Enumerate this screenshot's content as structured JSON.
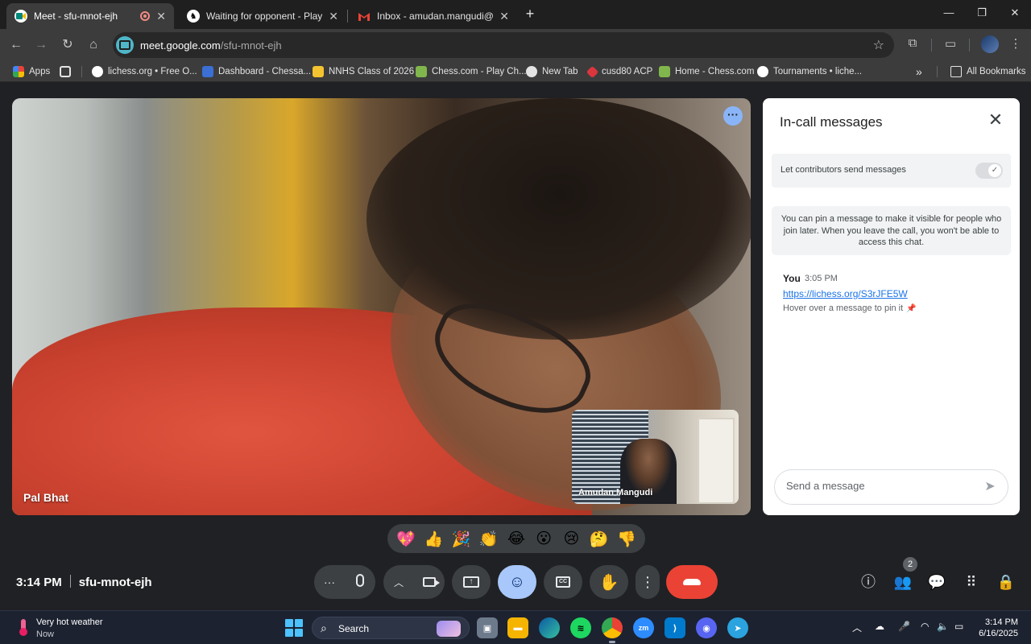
{
  "browser": {
    "tabs": [
      {
        "title": "Meet - sfu-mnot-ejh",
        "favicon": "google-meet-icon",
        "active": true,
        "recording": true
      },
      {
        "title": "Waiting for opponent - Play An",
        "favicon": "lichess-icon",
        "active": false
      },
      {
        "title": "Inbox - amudan.mangudi@gm",
        "favicon": "gmail-icon",
        "active": false
      }
    ],
    "url_host": "meet.google.com",
    "url_path": "/sfu-mnot-ejh",
    "bookmarks": [
      {
        "label": "Apps",
        "icon": "apps-grid-icon"
      },
      {
        "label": "",
        "icon": "apps-launcher-icon"
      },
      {
        "label": "lichess.org • Free O...",
        "icon": "lichess-icon"
      },
      {
        "label": "Dashboard - Chessa...",
        "icon": "chessable-icon"
      },
      {
        "label": "NNHS Class of 2026",
        "icon": "nnhs-icon"
      },
      {
        "label": "Chess.com - Play Ch...",
        "icon": "chesscom-icon"
      },
      {
        "label": "New Tab",
        "icon": "globe-icon"
      },
      {
        "label": "cusd80 ACP",
        "icon": "cusd80-icon"
      },
      {
        "label": "Home - Chess.com",
        "icon": "chesscom-icon"
      },
      {
        "label": "Tournaments • liche...",
        "icon": "lichess-icon"
      }
    ],
    "all_bookmarks": "All Bookmarks"
  },
  "meet": {
    "main_participant": "Pal Bhat",
    "self_participant": "Amudan Mangudi",
    "meeting_time": "3:14 PM",
    "meeting_code": "sfu-mnot-ejh",
    "participant_count": "2",
    "reactions": [
      "💖",
      "👍",
      "🎉",
      "👏",
      "😂",
      "😮",
      "😢",
      "🤔",
      "👎"
    ]
  },
  "chat": {
    "title": "In-call messages",
    "setting_label": "Let contributors send messages",
    "setting_enabled": true,
    "info_text": "You can pin a message to make it visible for people who join later. When you leave the call, you won't be able to access this chat.",
    "messages": [
      {
        "sender": "You",
        "time": "3:05 PM",
        "text": "https://lichess.org/S3rJFE5W"
      }
    ],
    "hint": "Hover over a message to pin it",
    "input_placeholder": "Send a message"
  },
  "taskbar": {
    "weather_title": "Very hot weather",
    "weather_sub": "Now",
    "search_label": "Search",
    "time": "3:14 PM",
    "date": "6/16/2025"
  },
  "colors": {
    "meet_bg": "#202124",
    "accent_blue": "#a8c7fa",
    "end_call_red": "#ea4335",
    "link_blue": "#1a73e8"
  }
}
